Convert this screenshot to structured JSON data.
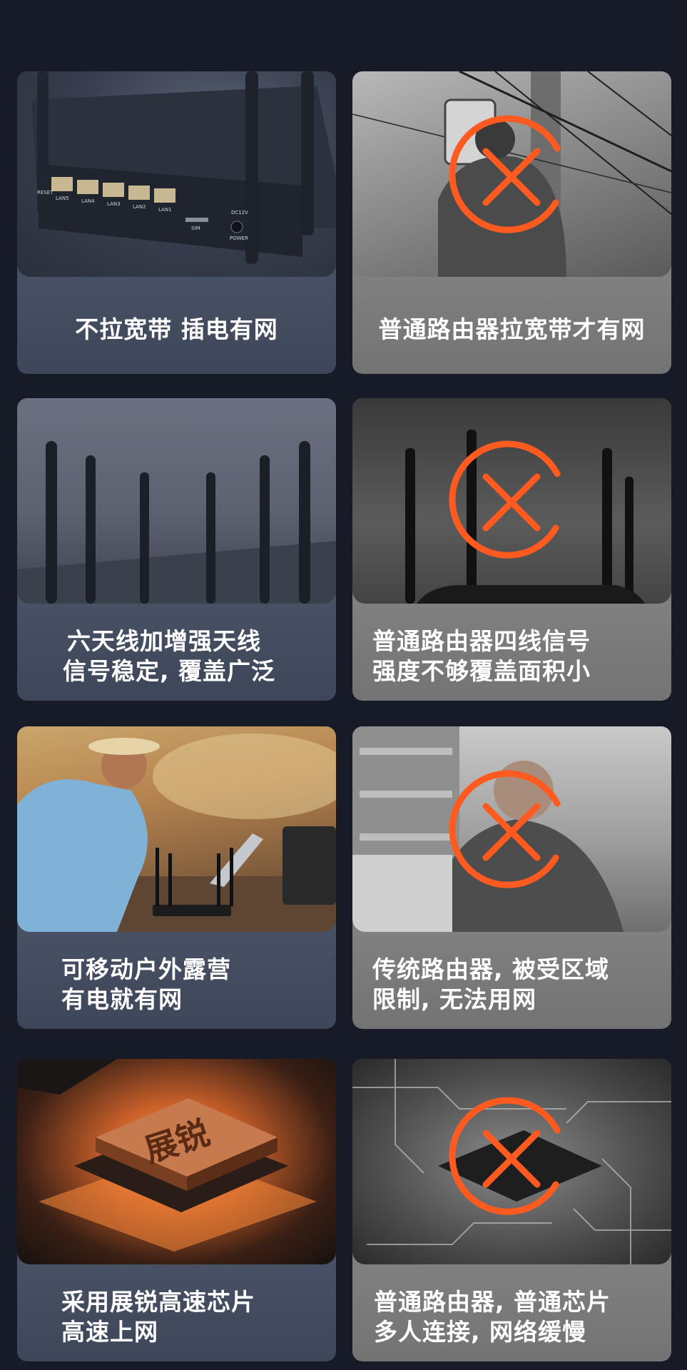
{
  "cards": [
    {
      "image": "router-rear-ports-photo",
      "lines": [
        "不拉宽带 插电有网"
      ],
      "port_labels": [
        "LAN5",
        "LAN4",
        "LAN3",
        "LAN2",
        "LAN1"
      ],
      "sim_label": "SIM",
      "dc_label": "DC12V",
      "power_label": "POWER",
      "reset_label": "RESET"
    },
    {
      "image": "technician-on-pole-photo",
      "icon": "x-circle-icon",
      "lines": [
        "普通路由器拉宽带才有网"
      ]
    },
    {
      "image": "six-antennas-photo",
      "lines": [
        "六天线加增强天线",
        "信号稳定, 覆盖广泛"
      ]
    },
    {
      "image": "four-antenna-router-photo",
      "icon": "x-circle-icon",
      "lines": [
        "普通路由器四线信号",
        "强度不够覆盖面积小"
      ]
    },
    {
      "image": "outdoor-camping-laptop-photo",
      "lines": [
        "可移动户外露营",
        "有电就有网"
      ]
    },
    {
      "image": "frustrated-office-man-photo",
      "icon": "x-circle-icon",
      "lines": [
        "传统路由器, 被受区域",
        "限制, 无法用网"
      ]
    },
    {
      "image": "glowing-chip-photo",
      "chip_logo_text": "展锐",
      "lines": [
        "采用展锐高速芯片",
        "高速上网"
      ]
    },
    {
      "image": "grayscale-circuit-board-photo",
      "icon": "x-circle-icon",
      "lines": [
        "普通路由器, 普通芯片",
        "多人连接, 网络缓慢"
      ]
    }
  ],
  "colors": {
    "page_bg": "#171a27",
    "accent": "#ff5a1f"
  }
}
